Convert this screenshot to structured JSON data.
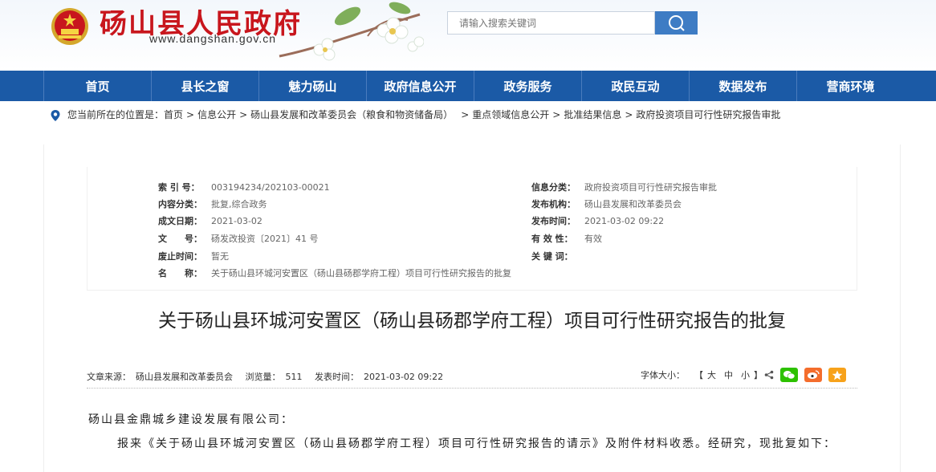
{
  "header": {
    "site_title": "砀山县人民政府",
    "site_url": "www.dangshan.gov.cn",
    "search_placeholder": "请输入搜索关键词"
  },
  "nav": {
    "items": [
      "首页",
      "县长之窗",
      "魅力砀山",
      "政府信息公开",
      "政务服务",
      "政民互动",
      "数据发布",
      "营商环境"
    ]
  },
  "breadcrumb": {
    "prefix": "您当前所在的位置是：",
    "items": [
      "首页",
      "信息公开",
      "砀山县发展和改革委员会（粮食和物资储备局）",
      "重点领域信息公开",
      "批准结果信息",
      "政府投资项目可行性研究报告审批"
    ]
  },
  "meta": {
    "index_label": "索 引 号：",
    "index_value": "003194234/202103-00021",
    "category_label": "信息分类：",
    "category_value": "政府投资项目可行性研究报告审批",
    "content_type_label": "内容分类：",
    "content_type_value": "批复,综合政务",
    "publisher_label": "发布机构：",
    "publisher_value": "砀山县发展和改革委员会",
    "created_label": "成文日期：",
    "created_value": "2021-03-02",
    "published_label": "发布时间：",
    "published_value": "2021-03-02 09:22",
    "doc_no_label": "文　　号：",
    "doc_no_value": "砀发改投资〔2021〕41 号",
    "validity_label": "有 效 性：",
    "validity_value": "有效",
    "repeal_label": "废止时间：",
    "repeal_value": "暂无",
    "keywords_label": "关 键 词：",
    "keywords_value": "",
    "name_label": "名　　称：",
    "name_value": "关于砀山县环城河安置区（砀山县砀郡学府工程）项目可行性研究报告的批复"
  },
  "article": {
    "title": "关于砀山县环城河安置区（砀山县砀郡学府工程）项目可行性研究报告的批复",
    "source_label": "文章来源：",
    "source_value": "砀山县发展和改革委员会",
    "views_label": "浏览量：",
    "views_value": "511",
    "date_label": "发表时间：",
    "date_value": "2021-03-02 09:22",
    "font_size_label": "字体大小：",
    "font_size_open": "【",
    "font_large": "大",
    "font_medium": "中",
    "font_small": "小",
    "font_size_close": "】",
    "salutation": "砀山县金鼎城乡建设发展有限公司：",
    "paragraph1": "报来《关于砀山县环城河安置区（砀山县砀郡学府工程）项目可行性研究报告的请示》及附件材料收悉。经研究，现批复如下："
  },
  "colors": {
    "brand_red": "#c8161d",
    "nav_blue": "#1b5aa6",
    "search_blue": "#3e7cc4",
    "wechat_green": "#2dc100",
    "weibo_orange": "#f46d2c",
    "favorite_yellow": "#f7a21b"
  },
  "icons": [
    "national-emblem-icon",
    "search-icon",
    "location-pin-icon",
    "share-icon",
    "wechat-icon",
    "weibo-icon",
    "favorite-icon"
  ]
}
